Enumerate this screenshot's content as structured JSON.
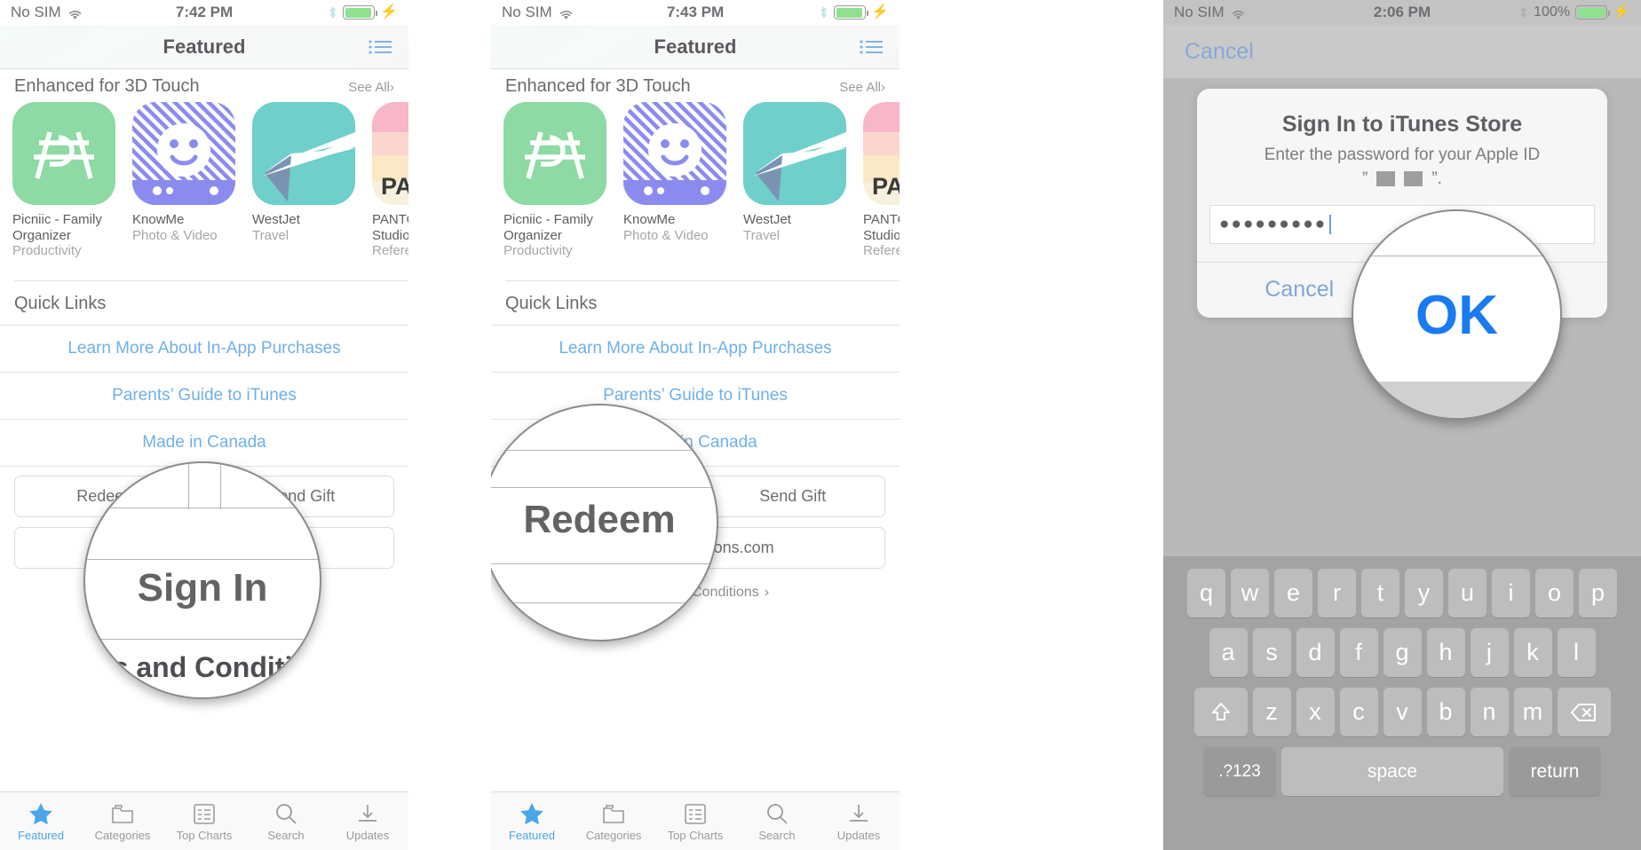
{
  "panel1": {
    "status": {
      "carrier": "No SIM",
      "wifi_icon": "wifi-icon",
      "time": "7:42 PM",
      "bluetooth_icon": "bluetooth-icon",
      "battery_icon": "battery-icon",
      "charging_icon": "bolt-icon"
    },
    "nav": {
      "title": "Featured",
      "list_icon": "list-icon"
    },
    "section": {
      "heading": "Enhanced for 3D Touch",
      "see_all": "See All",
      "chevron": "›"
    },
    "apps": [
      {
        "name": "Picniic - Family Organizer",
        "category": "Productivity",
        "icon": "picniic-app-icon"
      },
      {
        "name": "KnowMe",
        "category": "Photo & Video",
        "icon": "knowme-app-icon"
      },
      {
        "name": "WestJet",
        "category": "Travel",
        "icon": "westjet-app-icon"
      },
      {
        "name": "PANTONE Studio",
        "category": "Reference",
        "icon": "pantone-app-icon"
      }
    ],
    "quick_links": {
      "title": "Quick Links",
      "links": [
        "Learn More About In-App Purchases",
        "Parents’ Guide to iTunes",
        "Made in Canada"
      ]
    },
    "buttons": {
      "redeem": "Redeem",
      "send_gift": "Send Gift",
      "sign_in": "Sign In"
    },
    "terms": {
      "label": "Terms and Conditions",
      "chevron": "›"
    },
    "magnifier": {
      "label": "Sign In"
    },
    "tabs": [
      {
        "label": "Featured",
        "icon": "star-icon",
        "active": true
      },
      {
        "label": "Categories",
        "icon": "categories-icon",
        "active": false
      },
      {
        "label": "Top Charts",
        "icon": "top-charts-icon",
        "active": false
      },
      {
        "label": "Search",
        "icon": "search-icon",
        "active": false
      },
      {
        "label": "Updates",
        "icon": "updates-icon",
        "active": false
      }
    ]
  },
  "panel2": {
    "status": {
      "carrier": "No SIM",
      "wifi_icon": "wifi-icon",
      "time": "7:43 PM",
      "bluetooth_icon": "bluetooth-icon",
      "battery_icon": "battery-icon",
      "charging_icon": "bolt-icon"
    },
    "nav": {
      "title": "Featured",
      "list_icon": "list-icon"
    },
    "section": {
      "heading": "Enhanced for 3D Touch",
      "see_all": "See All",
      "chevron": "›"
    },
    "apps": [
      {
        "name": "Picniic - Family Organizer",
        "category": "Productivity",
        "icon": "picniic-app-icon"
      },
      {
        "name": "KnowMe",
        "category": "Photo & Video",
        "icon": "knowme-app-icon"
      },
      {
        "name": "WestJet",
        "category": "Travel",
        "icon": "westjet-app-icon"
      },
      {
        "name": "PANTONE Studio",
        "category": "Reference",
        "icon": "pantone-app-icon"
      }
    ],
    "quick_links": {
      "title": "Quick Links",
      "links": [
        "Learn More About In-App Purchases",
        "Parents’ Guide to iTunes",
        "Made in Canada"
      ]
    },
    "buttons": {
      "redeem": "Redeem",
      "send_gift": "Send Gift",
      "account": "k@mobilenations.com"
    },
    "terms": {
      "label": "Terms and Conditions",
      "chevron": "›"
    },
    "magnifier": {
      "label": "Redeem"
    },
    "tabs": [
      {
        "label": "Featured",
        "icon": "star-icon",
        "active": true
      },
      {
        "label": "Categories",
        "icon": "categories-icon",
        "active": false
      },
      {
        "label": "Top Charts",
        "icon": "top-charts-icon",
        "active": false
      },
      {
        "label": "Search",
        "icon": "search-icon",
        "active": false
      },
      {
        "label": "Updates",
        "icon": "updates-icon",
        "active": false
      }
    ]
  },
  "panel3": {
    "status": {
      "carrier": "No SIM",
      "wifi_icon": "wifi-icon",
      "time": "2:06 PM",
      "bluetooth_icon": "bluetooth-icon",
      "battery_pct": "100%",
      "battery_icon": "battery-icon",
      "charging_icon": "bolt-icon"
    },
    "cancel_bar": {
      "label": "Cancel"
    },
    "alert": {
      "title": "Sign In to iTunes Store",
      "subtitle": "Enter the password for your Apple ID",
      "redacted_quote_open": "”",
      "redacted_quote_close": "”.",
      "password_value": "●●●●●●●●●",
      "cancel": "Cancel",
      "ok": "OK"
    },
    "magnifier": {
      "label": "OK"
    },
    "keyboard": {
      "row1": [
        "q",
        "w",
        "e",
        "r",
        "t",
        "y",
        "u",
        "i",
        "o",
        "p"
      ],
      "row2": [
        "a",
        "s",
        "d",
        "f",
        "g",
        "h",
        "j",
        "k",
        "l"
      ],
      "row3": [
        "z",
        "x",
        "c",
        "v",
        "b",
        "n",
        "m"
      ],
      "shift_icon": "shift-icon",
      "backspace_icon": "backspace-icon",
      "numbers_key": ".?123",
      "space_key": "space",
      "return_key": "return"
    }
  },
  "colors": {
    "link_blue": "#6fb0e8",
    "tab_active": "#4aa6e8",
    "ok_blue": "#1a7bf0",
    "picniic_green": "#8ddaa4",
    "knowme_purple": "#8b8bef",
    "westjet_teal": "#6ecfcb",
    "keyboard_bg": "#a3a3a3"
  }
}
